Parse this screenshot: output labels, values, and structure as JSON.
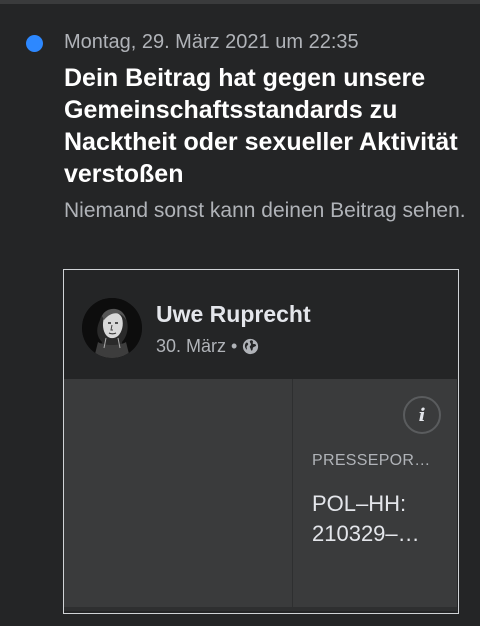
{
  "notification": {
    "timestamp": "Montag, 29. März 2021 um 22:35",
    "headline": "Dein Beitrag hat gegen unsere Gemeinschaftsstandards zu Nacktheit oder sexueller Aktivität verstoßen",
    "subline": "Niemand sonst kann deinen Beitrag sehen.",
    "unread": true
  },
  "post": {
    "author": "Uwe Ruprecht",
    "date": "30. März",
    "separator": "•",
    "audience_icon": "globe-icon"
  },
  "link_preview": {
    "info_icon": "info-icon",
    "info_glyph": "i",
    "domain": "PRESSEPOR…",
    "title": "POL–HH:\n210329–…"
  },
  "colors": {
    "background": "#242526",
    "unread_dot": "#2d88ff",
    "primary_text": "#ffffff",
    "secondary_text": "#b0b3b8",
    "preview_bg": "#3a3b3c"
  }
}
